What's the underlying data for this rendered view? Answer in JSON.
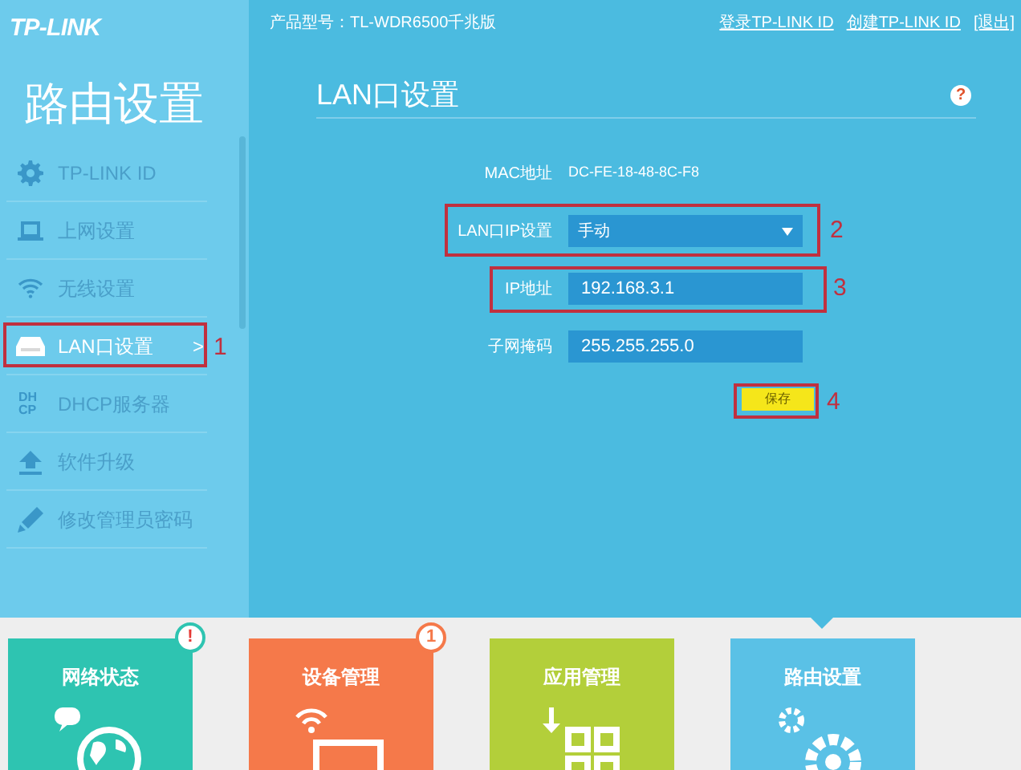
{
  "header": {
    "logo": "TP-LINK",
    "model": "产品型号：TL-WDR6500千兆版",
    "links": [
      "登录TP-LINK ID",
      "创建TP-LINK ID",
      "[退出]"
    ]
  },
  "sidebar": {
    "title": "路由设置",
    "items": [
      {
        "label": "TP-LINK ID",
        "kind": "gear",
        "selected": false
      },
      {
        "label": "上网设置",
        "kind": "laptop",
        "selected": false
      },
      {
        "label": "无线设置",
        "kind": "wifi",
        "selected": false
      },
      {
        "label": "LAN口设置",
        "kind": "router",
        "selected": true,
        "chevron": ">",
        "annotation": "1"
      },
      {
        "label": "DHCP服务器",
        "kind": "text",
        "icon_text": "DHCP",
        "selected": false
      },
      {
        "label": "软件升级",
        "kind": "upload",
        "selected": false
      },
      {
        "label": "修改管理员密码",
        "kind": "pencil",
        "selected": false
      }
    ]
  },
  "panel": {
    "title": "LAN口设置",
    "help": "?",
    "fields": [
      {
        "kind": "text",
        "label": "MAC地址",
        "value": "DC-FE-18-48-8C-F8"
      },
      {
        "kind": "select",
        "label": "LAN口IP设置",
        "value": "手动",
        "annotation": "2"
      },
      {
        "kind": "input",
        "label": "IP地址",
        "value": "192.168.3.1",
        "annotation": "3"
      },
      {
        "kind": "input",
        "label": "子网掩码",
        "value": "255.255.255.0"
      }
    ],
    "save_button": {
      "label": "保存",
      "annotation": "4"
    }
  },
  "tiles": [
    {
      "label": "网络状态",
      "kind": "globe",
      "color": "#2ec4b1",
      "badge": "!",
      "selected": false
    },
    {
      "label": "设备管理",
      "kind": "laptop",
      "color": "#f5794a",
      "badge": "1",
      "selected": false
    },
    {
      "label": "应用管理",
      "kind": "apps",
      "color": "#b3cf3a",
      "selected": false
    },
    {
      "label": "路由设置",
      "kind": "gear",
      "color": "#5ac1e6",
      "selected": true
    }
  ]
}
